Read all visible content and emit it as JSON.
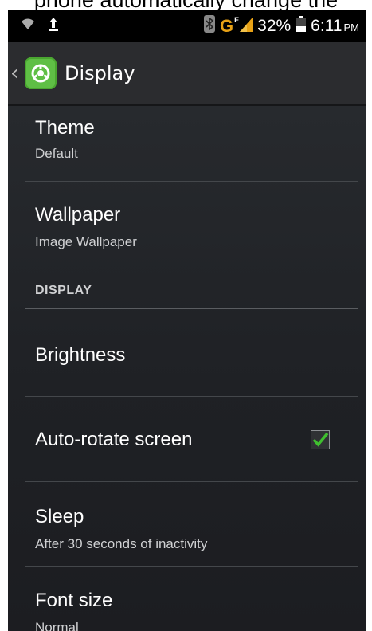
{
  "caption": "phone automatically change the",
  "status_bar": {
    "battery_percent": "32%",
    "time": "6:11",
    "ampm": "PM",
    "network": "G",
    "network_sup": "E",
    "icons": [
      "wifi-icon",
      "upload-icon",
      "bluetooth-icon",
      "signal-icon",
      "battery-icon"
    ]
  },
  "action_bar": {
    "back_glyph": "‹",
    "title": "Display",
    "icon": "settings-gear-icon",
    "icon_color": "#5fbf45"
  },
  "list": {
    "theme": {
      "title": "Theme",
      "summary": "Default"
    },
    "wallpaper": {
      "title": "Wallpaper",
      "summary": "Image Wallpaper"
    },
    "section_display": "DISPLAY",
    "brightness": {
      "title": "Brightness"
    },
    "auto_rotate": {
      "title": "Auto-rotate screen",
      "checked": true
    },
    "sleep": {
      "title": "Sleep",
      "summary": "After 30 seconds of inactivity"
    },
    "font_size": {
      "title": "Font size",
      "summary": "Normal"
    }
  },
  "colors": {
    "checkmark": "#3fbf2f",
    "background": "#222428",
    "status_bar": "#000000"
  }
}
